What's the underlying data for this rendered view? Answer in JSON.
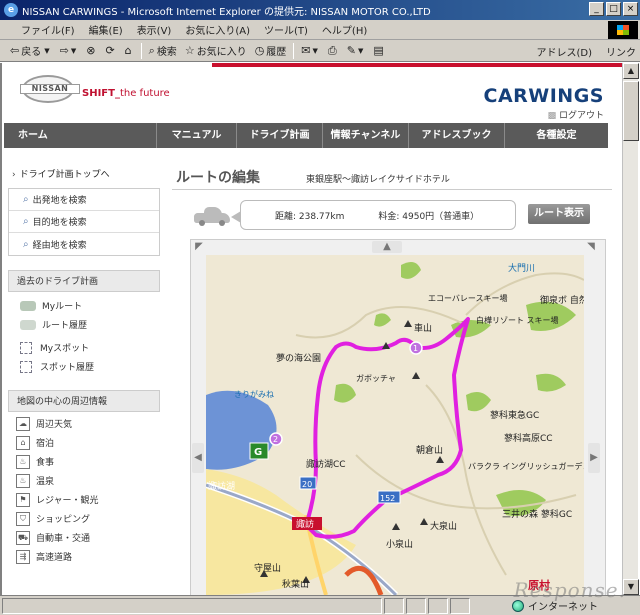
{
  "window": {
    "title": "NISSAN CARWINGS - Microsoft Internet Explorer の提供元: NISSAN MOTOR CO.,LTD",
    "icon": "ie-icon"
  },
  "menu": [
    "ファイル(F)",
    "編集(E)",
    "表示(V)",
    "お気に入り(A)",
    "ツール(T)",
    "ヘルプ(H)"
  ],
  "toolbar": {
    "back": "戻る",
    "search": "検索",
    "favorites": "お気に入り",
    "history": "履歴",
    "address": "アドレス(D)",
    "links": "リンク"
  },
  "site": {
    "logo": "NISSAN",
    "tagline_main": "SHIFT_",
    "tagline_sub": "the future",
    "brand": "CARWINGS",
    "logout": "ログアウト"
  },
  "nav": [
    "ホーム",
    "マニュアル",
    "ドライブ計画",
    "情報チャンネル",
    "アドレスブック",
    "各種設定"
  ],
  "sidebar": {
    "top_link": "ドライブ計画トップへ",
    "search_items": [
      "出発地を検索",
      "目的地を検索",
      "経由地を検索"
    ],
    "past_plans_title": "過去のドライブ計画",
    "past_items": [
      "Myルート",
      "ルート履歴",
      "Myスポット",
      "スポット履歴"
    ],
    "nearby_title": "地図の中心の周辺情報",
    "nearby_items": [
      "周辺天気",
      "宿泊",
      "食事",
      "温泉",
      "レジャー・観光",
      "ショッピング",
      "自動車・交通",
      "高速道路"
    ]
  },
  "main": {
    "title": "ルートの編集",
    "subtitle": "東銀座駅～諏訪レイクサイドホテル",
    "distance": "距離: 238.77km",
    "fee": "料金: 4950円（普通車）",
    "route_button": "ルート表示"
  },
  "map": {
    "labels": {
      "river": "大門川",
      "ski1": "エコーバレースキー場",
      "ski2": "白樺リゾート スキー場",
      "nature": "御泉ボ 自然園",
      "kurumayama": "車山",
      "yumenoumi": "夢の海公園",
      "garbocha": "ガボッチャ",
      "kirigamine": "きりがみね",
      "tateshina_kyu": "蓼科東急GC",
      "tateshina_kogen": "蓼科高原CC",
      "asakurayama": "朝倉山",
      "suwako_cc": "諏訪湖CC",
      "barakura": "バラクラ イングリッシュガーデン",
      "suwako": "諏訪湖",
      "route20": "20",
      "route152": "152",
      "suwa": "諏訪",
      "koizumiyama": "小泉山",
      "oizumiyama": "大泉山",
      "sannomori": "三井の森 蓼科GC",
      "moriyasan": "守屋山",
      "akihasan": "秋葉山",
      "haramura": "原村"
    }
  },
  "status": {
    "zone": "インターネット"
  },
  "watermark": "Response."
}
